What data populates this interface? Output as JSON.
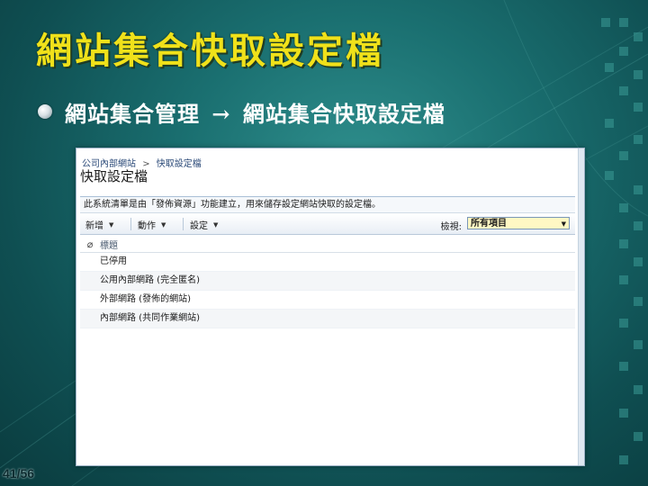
{
  "slide": {
    "title": "網站集合快取設定檔",
    "bullet": {
      "part1": "網站集合管理",
      "arrow": "→",
      "part2": "網站集合快取設定檔"
    },
    "page_number": "41/56"
  },
  "sharepoint": {
    "breadcrumb": [
      "公司內部網站",
      "快取設定檔"
    ],
    "breadcrumb_separator": ">",
    "page_title": "快取設定檔",
    "description": "此系統清單是由「發佈資源」功能建立，用來儲存設定網站快取的設定檔。",
    "toolbar": {
      "new_label": "新增",
      "actions_label": "動作",
      "settings_label": "設定",
      "view_label": "檢視:",
      "view_value": "所有項目"
    },
    "list": {
      "header_title": "標題",
      "items": [
        "已停用",
        "公用內部網路 (完全匿名)",
        "外部網路 (發佈的網站)",
        "內部網路 (共同作業網站)"
      ]
    }
  },
  "colors": {
    "title_yellow": "#f0e11a",
    "background_teal": "#1a6f70"
  },
  "icons": {
    "bullet": "round-bullet-icon",
    "attachment": "paperclip-icon",
    "dropdown": "chevron-down-icon"
  }
}
